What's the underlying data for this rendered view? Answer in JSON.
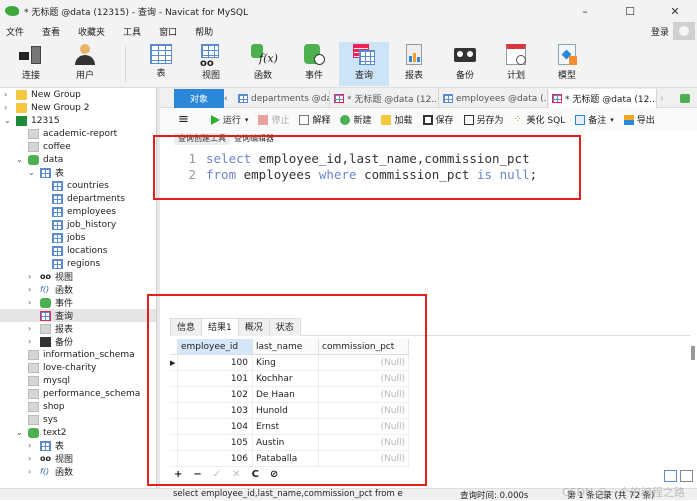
{
  "window": {
    "title": "* 无标题 @data (12315) - 查询 - Navicat for MySQL",
    "controls": {
      "minimize": "–",
      "maximize": "☐",
      "close": "✕"
    }
  },
  "menu": [
    "文件",
    "查看",
    "收藏夹",
    "工具",
    "窗口",
    "帮助"
  ],
  "account": {
    "login_label": "登录"
  },
  "ribbon": [
    {
      "label": "连接",
      "icon": "connection-icon"
    },
    {
      "label": "用户",
      "icon": "user-icon"
    },
    {
      "label": "表",
      "icon": "table-icon"
    },
    {
      "label": "视图",
      "icon": "view-icon"
    },
    {
      "label": "函数",
      "icon": "function-icon"
    },
    {
      "label": "事件",
      "icon": "event-icon"
    },
    {
      "label": "查询",
      "icon": "query-icon",
      "active": true
    },
    {
      "label": "报表",
      "icon": "report-icon"
    },
    {
      "label": "备份",
      "icon": "backup-icon"
    },
    {
      "label": "计划",
      "icon": "schedule-icon"
    },
    {
      "label": "模型",
      "icon": "model-icon"
    }
  ],
  "sidebar": {
    "items": [
      {
        "label": "New Group",
        "type": "folder",
        "level": 0,
        "expander": "›"
      },
      {
        "label": "New Group 2",
        "type": "folder",
        "level": 0,
        "expander": "›"
      },
      {
        "label": "12315",
        "type": "connection",
        "level": 0,
        "expander": "⌄"
      },
      {
        "label": "academic-report",
        "type": "db-grey",
        "level": 1
      },
      {
        "label": "coffee",
        "type": "db-grey",
        "level": 1
      },
      {
        "label": "data",
        "type": "db-green",
        "level": 1,
        "expander": "⌄"
      },
      {
        "label": "表",
        "type": "table",
        "level": 2,
        "expander": "⌄"
      },
      {
        "label": "countries",
        "type": "table",
        "level": 3
      },
      {
        "label": "departments",
        "type": "table",
        "level": 3
      },
      {
        "label": "employees",
        "type": "table",
        "level": 3
      },
      {
        "label": "job_history",
        "type": "table",
        "level": 3
      },
      {
        "label": "jobs",
        "type": "table",
        "level": 3
      },
      {
        "label": "locations",
        "type": "table",
        "level": 3
      },
      {
        "label": "regions",
        "type": "table",
        "level": 3
      },
      {
        "label": "视图",
        "type": "view",
        "level": 2,
        "expander": "›"
      },
      {
        "label": "函数",
        "type": "function",
        "level": 2,
        "expander": "›"
      },
      {
        "label": "事件",
        "type": "event",
        "level": 2,
        "expander": "›"
      },
      {
        "label": "查询",
        "type": "query",
        "level": 2,
        "selected": true
      },
      {
        "label": "报表",
        "type": "report",
        "level": 2,
        "expander": "›"
      },
      {
        "label": "备份",
        "type": "backup",
        "level": 2,
        "expander": "›"
      },
      {
        "label": "information_schema",
        "type": "db-grey",
        "level": 1
      },
      {
        "label": "love-charity",
        "type": "db-grey",
        "level": 1
      },
      {
        "label": "mysql",
        "type": "db-grey",
        "level": 1
      },
      {
        "label": "performance_schema",
        "type": "db-grey",
        "level": 1
      },
      {
        "label": "shop",
        "type": "db-grey",
        "level": 1
      },
      {
        "label": "sys",
        "type": "db-grey",
        "level": 1
      },
      {
        "label": "text2",
        "type": "db-green",
        "level": 1,
        "expander": "⌄"
      },
      {
        "label": "表",
        "type": "table",
        "level": 2,
        "expander": "›"
      },
      {
        "label": "视图",
        "type": "view",
        "level": 2,
        "expander": "›"
      },
      {
        "label": "函数",
        "type": "function",
        "level": 2,
        "expander": "›"
      }
    ]
  },
  "tabs": {
    "objects_label": "对象",
    "prev_arrow": "‹",
    "next_arrow": "›",
    "items": [
      {
        "label": "departments @dat...",
        "icon": "table-icon"
      },
      {
        "label": "* 无标题 @data (12...",
        "icon": "query-icon"
      },
      {
        "label": "employees @data (...",
        "icon": "table-icon"
      },
      {
        "label": "* 无标题 @data (12...",
        "icon": "query-icon",
        "active": true
      }
    ]
  },
  "toolbar": {
    "menu": "≡",
    "run": "运行",
    "stop": "停止",
    "explain": "解释",
    "new": "新建",
    "load": "加载",
    "save": "保存",
    "save_as": "另存为",
    "beautify": "美化 SQL",
    "comment": "备注",
    "export": "导出"
  },
  "editor": {
    "subtabs": [
      "查询创建工具",
      "查询编辑器"
    ],
    "lines": [
      {
        "n": "1",
        "tokens": [
          {
            "t": "select",
            "k": true
          },
          {
            "t": " employee_id,last_name,commission_pct",
            "k": false
          }
        ]
      },
      {
        "n": "2",
        "tokens": [
          {
            "t": "from",
            "k": true
          },
          {
            "t": " employees ",
            "k": false
          },
          {
            "t": "where",
            "k": true
          },
          {
            "t": " commission_pct ",
            "k": false
          },
          {
            "t": "is",
            "k": true
          },
          {
            "t": " ",
            "k": false
          },
          {
            "t": "null",
            "k": true
          },
          {
            "t": ";",
            "k": false
          }
        ]
      }
    ]
  },
  "results": {
    "tabs": [
      "信息",
      "结果1",
      "概况",
      "状态"
    ],
    "active_tab": 1,
    "columns": [
      "employee_id",
      "last_name",
      "commission_pct"
    ],
    "rows": [
      [
        "100",
        "King",
        "(Null)"
      ],
      [
        "101",
        "Kochhar",
        "(Null)"
      ],
      [
        "102",
        "De Haan",
        "(Null)"
      ],
      [
        "103",
        "Hunold",
        "(Null)"
      ],
      [
        "104",
        "Ernst",
        "(Null)"
      ],
      [
        "105",
        "Austin",
        "(Null)"
      ],
      [
        "106",
        "Pataballa",
        "(Null)"
      ]
    ],
    "actions": [
      "+",
      "−",
      "✓",
      "✕",
      "C",
      "⊘"
    ]
  },
  "status": {
    "sql": "select employee_id,last_name,commission_pct from e",
    "query_time": "查询时间: 0.000s",
    "record": "第 1 条记录 (共 72 条)",
    "watermark": "CSDN @一个的编程之路"
  },
  "colors": {
    "accent": "#2b88d8",
    "highlight_box": "#e0201c",
    "keyword": "#6a85d6"
  }
}
